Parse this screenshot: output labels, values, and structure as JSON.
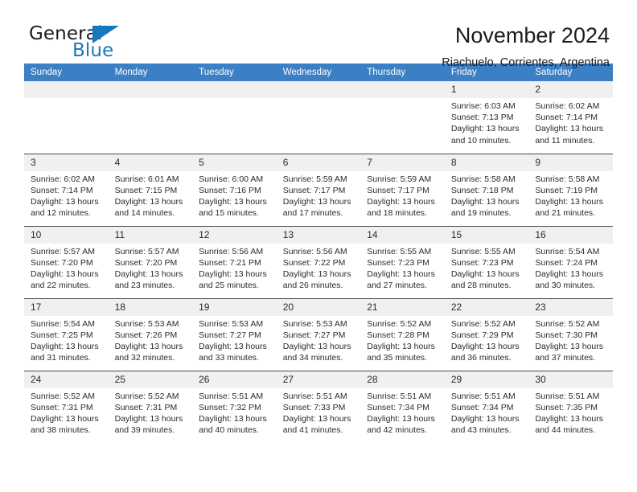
{
  "brand": {
    "name_part1": "General",
    "name_part2": "Blue",
    "flag_icon": "triangle-flag-icon"
  },
  "header": {
    "month_title": "November 2024",
    "location": "Riachuelo, Corrientes, Argentina"
  },
  "calendar": {
    "accent_color": "#3b7fc4",
    "daynum_band_color": "#f0f0f0",
    "weekday_headers": [
      "Sunday",
      "Monday",
      "Tuesday",
      "Wednesday",
      "Thursday",
      "Friday",
      "Saturday"
    ],
    "weeks": [
      [
        {
          "day": "",
          "sunrise": "",
          "sunset": "",
          "daylight_line1": "",
          "daylight_line2": ""
        },
        {
          "day": "",
          "sunrise": "",
          "sunset": "",
          "daylight_line1": "",
          "daylight_line2": ""
        },
        {
          "day": "",
          "sunrise": "",
          "sunset": "",
          "daylight_line1": "",
          "daylight_line2": ""
        },
        {
          "day": "",
          "sunrise": "",
          "sunset": "",
          "daylight_line1": "",
          "daylight_line2": ""
        },
        {
          "day": "",
          "sunrise": "",
          "sunset": "",
          "daylight_line1": "",
          "daylight_line2": ""
        },
        {
          "day": "1",
          "sunrise": "Sunrise: 6:03 AM",
          "sunset": "Sunset: 7:13 PM",
          "daylight_line1": "Daylight: 13 hours",
          "daylight_line2": "and 10 minutes."
        },
        {
          "day": "2",
          "sunrise": "Sunrise: 6:02 AM",
          "sunset": "Sunset: 7:14 PM",
          "daylight_line1": "Daylight: 13 hours",
          "daylight_line2": "and 11 minutes."
        }
      ],
      [
        {
          "day": "3",
          "sunrise": "Sunrise: 6:02 AM",
          "sunset": "Sunset: 7:14 PM",
          "daylight_line1": "Daylight: 13 hours",
          "daylight_line2": "and 12 minutes."
        },
        {
          "day": "4",
          "sunrise": "Sunrise: 6:01 AM",
          "sunset": "Sunset: 7:15 PM",
          "daylight_line1": "Daylight: 13 hours",
          "daylight_line2": "and 14 minutes."
        },
        {
          "day": "5",
          "sunrise": "Sunrise: 6:00 AM",
          "sunset": "Sunset: 7:16 PM",
          "daylight_line1": "Daylight: 13 hours",
          "daylight_line2": "and 15 minutes."
        },
        {
          "day": "6",
          "sunrise": "Sunrise: 5:59 AM",
          "sunset": "Sunset: 7:17 PM",
          "daylight_line1": "Daylight: 13 hours",
          "daylight_line2": "and 17 minutes."
        },
        {
          "day": "7",
          "sunrise": "Sunrise: 5:59 AM",
          "sunset": "Sunset: 7:17 PM",
          "daylight_line1": "Daylight: 13 hours",
          "daylight_line2": "and 18 minutes."
        },
        {
          "day": "8",
          "sunrise": "Sunrise: 5:58 AM",
          "sunset": "Sunset: 7:18 PM",
          "daylight_line1": "Daylight: 13 hours",
          "daylight_line2": "and 19 minutes."
        },
        {
          "day": "9",
          "sunrise": "Sunrise: 5:58 AM",
          "sunset": "Sunset: 7:19 PM",
          "daylight_line1": "Daylight: 13 hours",
          "daylight_line2": "and 21 minutes."
        }
      ],
      [
        {
          "day": "10",
          "sunrise": "Sunrise: 5:57 AM",
          "sunset": "Sunset: 7:20 PM",
          "daylight_line1": "Daylight: 13 hours",
          "daylight_line2": "and 22 minutes."
        },
        {
          "day": "11",
          "sunrise": "Sunrise: 5:57 AM",
          "sunset": "Sunset: 7:20 PM",
          "daylight_line1": "Daylight: 13 hours",
          "daylight_line2": "and 23 minutes."
        },
        {
          "day": "12",
          "sunrise": "Sunrise: 5:56 AM",
          "sunset": "Sunset: 7:21 PM",
          "daylight_line1": "Daylight: 13 hours",
          "daylight_line2": "and 25 minutes."
        },
        {
          "day": "13",
          "sunrise": "Sunrise: 5:56 AM",
          "sunset": "Sunset: 7:22 PM",
          "daylight_line1": "Daylight: 13 hours",
          "daylight_line2": "and 26 minutes."
        },
        {
          "day": "14",
          "sunrise": "Sunrise: 5:55 AM",
          "sunset": "Sunset: 7:23 PM",
          "daylight_line1": "Daylight: 13 hours",
          "daylight_line2": "and 27 minutes."
        },
        {
          "day": "15",
          "sunrise": "Sunrise: 5:55 AM",
          "sunset": "Sunset: 7:23 PM",
          "daylight_line1": "Daylight: 13 hours",
          "daylight_line2": "and 28 minutes."
        },
        {
          "day": "16",
          "sunrise": "Sunrise: 5:54 AM",
          "sunset": "Sunset: 7:24 PM",
          "daylight_line1": "Daylight: 13 hours",
          "daylight_line2": "and 30 minutes."
        }
      ],
      [
        {
          "day": "17",
          "sunrise": "Sunrise: 5:54 AM",
          "sunset": "Sunset: 7:25 PM",
          "daylight_line1": "Daylight: 13 hours",
          "daylight_line2": "and 31 minutes."
        },
        {
          "day": "18",
          "sunrise": "Sunrise: 5:53 AM",
          "sunset": "Sunset: 7:26 PM",
          "daylight_line1": "Daylight: 13 hours",
          "daylight_line2": "and 32 minutes."
        },
        {
          "day": "19",
          "sunrise": "Sunrise: 5:53 AM",
          "sunset": "Sunset: 7:27 PM",
          "daylight_line1": "Daylight: 13 hours",
          "daylight_line2": "and 33 minutes."
        },
        {
          "day": "20",
          "sunrise": "Sunrise: 5:53 AM",
          "sunset": "Sunset: 7:27 PM",
          "daylight_line1": "Daylight: 13 hours",
          "daylight_line2": "and 34 minutes."
        },
        {
          "day": "21",
          "sunrise": "Sunrise: 5:52 AM",
          "sunset": "Sunset: 7:28 PM",
          "daylight_line1": "Daylight: 13 hours",
          "daylight_line2": "and 35 minutes."
        },
        {
          "day": "22",
          "sunrise": "Sunrise: 5:52 AM",
          "sunset": "Sunset: 7:29 PM",
          "daylight_line1": "Daylight: 13 hours",
          "daylight_line2": "and 36 minutes."
        },
        {
          "day": "23",
          "sunrise": "Sunrise: 5:52 AM",
          "sunset": "Sunset: 7:30 PM",
          "daylight_line1": "Daylight: 13 hours",
          "daylight_line2": "and 37 minutes."
        }
      ],
      [
        {
          "day": "24",
          "sunrise": "Sunrise: 5:52 AM",
          "sunset": "Sunset: 7:31 PM",
          "daylight_line1": "Daylight: 13 hours",
          "daylight_line2": "and 38 minutes."
        },
        {
          "day": "25",
          "sunrise": "Sunrise: 5:52 AM",
          "sunset": "Sunset: 7:31 PM",
          "daylight_line1": "Daylight: 13 hours",
          "daylight_line2": "and 39 minutes."
        },
        {
          "day": "26",
          "sunrise": "Sunrise: 5:51 AM",
          "sunset": "Sunset: 7:32 PM",
          "daylight_line1": "Daylight: 13 hours",
          "daylight_line2": "and 40 minutes."
        },
        {
          "day": "27",
          "sunrise": "Sunrise: 5:51 AM",
          "sunset": "Sunset: 7:33 PM",
          "daylight_line1": "Daylight: 13 hours",
          "daylight_line2": "and 41 minutes."
        },
        {
          "day": "28",
          "sunrise": "Sunrise: 5:51 AM",
          "sunset": "Sunset: 7:34 PM",
          "daylight_line1": "Daylight: 13 hours",
          "daylight_line2": "and 42 minutes."
        },
        {
          "day": "29",
          "sunrise": "Sunrise: 5:51 AM",
          "sunset": "Sunset: 7:34 PM",
          "daylight_line1": "Daylight: 13 hours",
          "daylight_line2": "and 43 minutes."
        },
        {
          "day": "30",
          "sunrise": "Sunrise: 5:51 AM",
          "sunset": "Sunset: 7:35 PM",
          "daylight_line1": "Daylight: 13 hours",
          "daylight_line2": "and 44 minutes."
        }
      ]
    ]
  }
}
